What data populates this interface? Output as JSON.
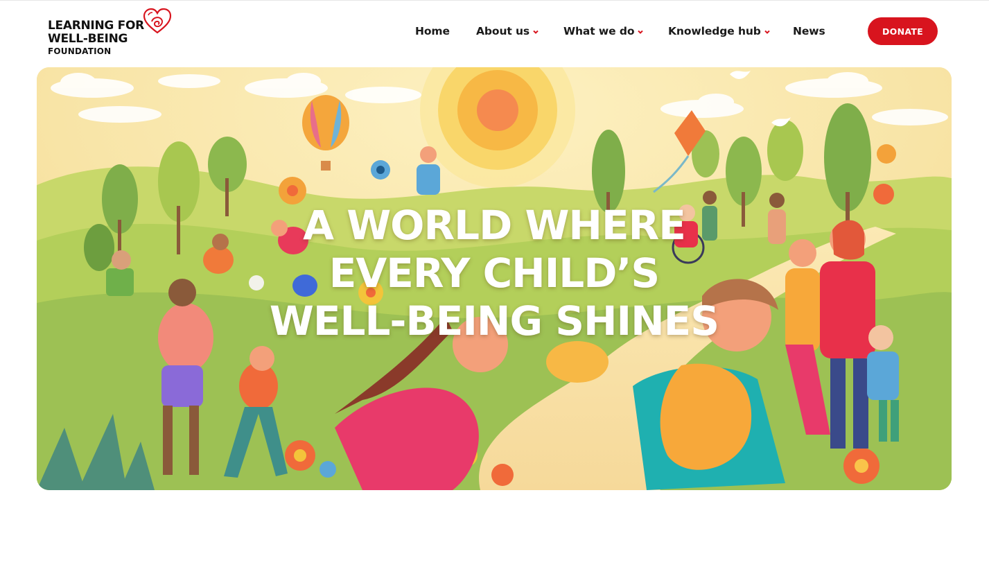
{
  "logo": {
    "line1": "LEARNING FOR",
    "line2": "WELL-BEING",
    "line3": "FOUNDATION",
    "icon": "heart-logo-icon"
  },
  "nav": {
    "items": [
      {
        "label": "Home",
        "has_dropdown": false
      },
      {
        "label": "About us",
        "has_dropdown": true
      },
      {
        "label": "What we do",
        "has_dropdown": true
      },
      {
        "label": "Knowledge hub",
        "has_dropdown": true
      },
      {
        "label": "News",
        "has_dropdown": false
      }
    ],
    "dropdown_icon": "chevron-down-icon"
  },
  "donate": {
    "label": "DONATE"
  },
  "hero": {
    "title_lines": [
      "A WORLD WHERE",
      "EVERY CHILD’S",
      "WELL-BEING SHINES"
    ]
  },
  "colors": {
    "brand_red": "#d8141e",
    "nav_text": "#1a1a1a",
    "hero_sky": "#f7e6b0",
    "hero_grass": "#a9c95a"
  }
}
